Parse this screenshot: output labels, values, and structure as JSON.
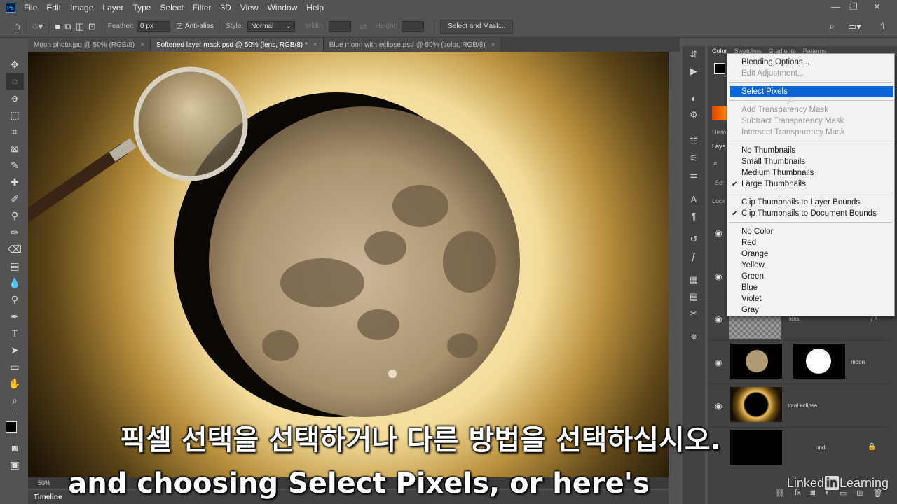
{
  "menubar": {
    "items": [
      "File",
      "Edit",
      "Image",
      "Layer",
      "Type",
      "Select",
      "Filter",
      "3D",
      "View",
      "Window",
      "Help"
    ]
  },
  "options": {
    "feather_label": "Feather:",
    "feather_value": "0 px",
    "antialias_label": "Anti-alias",
    "style_label": "Style:",
    "style_value": "Normal",
    "width_label": "Width:",
    "height_label": "Height:",
    "select_mask_button": "Select and Mask..."
  },
  "tabs": [
    {
      "label": "Moon photo.jpg @ 50% (RGB/8)"
    },
    {
      "label": "Softened layer mask.psd @ 50% (lens, RGB/8) *"
    },
    {
      "label": "Blue moon with eclipse.psd @ 50% (color, RGB/8)"
    }
  ],
  "panels": {
    "color_tabs": [
      "Color",
      "Swatches",
      "Gradients",
      "Patterns"
    ],
    "history_tab": "Histo",
    "layers_tab": "Laye",
    "blend_prefix": "Scr",
    "lock_prefix": "Lock",
    "layers": [
      {
        "name": "lens"
      },
      {
        "name": "moon"
      },
      {
        "name": "total eclipse"
      },
      {
        "name": "und"
      }
    ]
  },
  "context_menu": {
    "items": [
      {
        "label": "Blending Options...",
        "state": "normal"
      },
      {
        "label": "Edit Adjustment...",
        "state": "disabled"
      },
      {
        "label": "Select Pixels",
        "state": "highlighted"
      },
      {
        "label": "Add Transparency Mask",
        "state": "disabled"
      },
      {
        "label": "Subtract Transparency Mask",
        "state": "disabled"
      },
      {
        "label": "Intersect Transparency Mask",
        "state": "disabled"
      },
      {
        "label": "No Thumbnails",
        "state": "normal"
      },
      {
        "label": "Small Thumbnails",
        "state": "normal"
      },
      {
        "label": "Medium Thumbnails",
        "state": "normal"
      },
      {
        "label": "Large Thumbnails",
        "state": "checked"
      },
      {
        "label": "Clip Thumbnails to Layer Bounds",
        "state": "normal"
      },
      {
        "label": "Clip Thumbnails to Document Bounds",
        "state": "checked"
      },
      {
        "label": "No Color",
        "state": "normal"
      },
      {
        "label": "Red",
        "state": "normal"
      },
      {
        "label": "Orange",
        "state": "normal"
      },
      {
        "label": "Yellow",
        "state": "normal"
      },
      {
        "label": "Green",
        "state": "normal"
      },
      {
        "label": "Blue",
        "state": "normal"
      },
      {
        "label": "Violet",
        "state": "normal"
      },
      {
        "label": "Gray",
        "state": "normal"
      }
    ]
  },
  "status": {
    "zoom": "50%",
    "doc_prefix": "2"
  },
  "timeline_label": "Timeline",
  "subtitles": {
    "korean": "픽셀 선택을 선택하거나 다른 방법을 선택하십시오.",
    "english": "and choosing Select Pixels, or here's"
  },
  "watermark": {
    "prefix": "Linked",
    "badge": "in",
    "suffix": "Learning"
  },
  "colors": {
    "accent": "#0b64d3",
    "app_bg": "#535353",
    "panel_bg": "#424242"
  }
}
